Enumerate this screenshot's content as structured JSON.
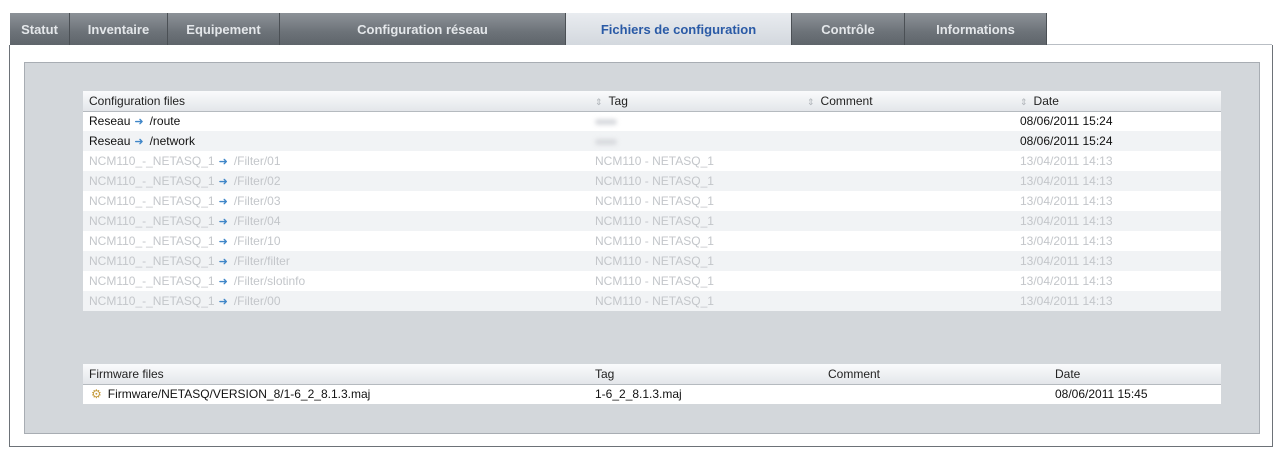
{
  "tabs": [
    {
      "label": "Statut",
      "active": false
    },
    {
      "label": "Inventaire",
      "active": false
    },
    {
      "label": "Equipement",
      "active": false
    },
    {
      "label": "Configuration réseau",
      "active": false
    },
    {
      "label": "Fichiers de configuration",
      "active": true
    },
    {
      "label": "Contrôle",
      "active": false
    },
    {
      "label": "Informations",
      "active": false
    }
  ],
  "config_table": {
    "headers": {
      "name": "Configuration files",
      "tag": "Tag",
      "comment": "Comment",
      "date": "Date"
    },
    "rows": [
      {
        "source": "Reseau",
        "path": "/route",
        "tag": "",
        "comment": "",
        "date": "08/06/2011 15:24",
        "dimmed": false
      },
      {
        "source": "Reseau",
        "path": "/network",
        "tag": "",
        "comment": "",
        "date": "08/06/2011 15:24",
        "dimmed": false
      },
      {
        "source": "NCM110_-_NETASQ_1",
        "path": "/Filter/01",
        "tag": "NCM110 - NETASQ_1",
        "comment": "",
        "date": "13/04/2011 14:13",
        "dimmed": true
      },
      {
        "source": "NCM110_-_NETASQ_1",
        "path": "/Filter/02",
        "tag": "NCM110 - NETASQ_1",
        "comment": "",
        "date": "13/04/2011 14:13",
        "dimmed": true
      },
      {
        "source": "NCM110_-_NETASQ_1",
        "path": "/Filter/03",
        "tag": "NCM110 - NETASQ_1",
        "comment": "",
        "date": "13/04/2011 14:13",
        "dimmed": true
      },
      {
        "source": "NCM110_-_NETASQ_1",
        "path": "/Filter/04",
        "tag": "NCM110 - NETASQ_1",
        "comment": "",
        "date": "13/04/2011 14:13",
        "dimmed": true
      },
      {
        "source": "NCM110_-_NETASQ_1",
        "path": "/Filter/10",
        "tag": "NCM110 - NETASQ_1",
        "comment": "",
        "date": "13/04/2011 14:13",
        "dimmed": true
      },
      {
        "source": "NCM110_-_NETASQ_1",
        "path": "/Filter/filter",
        "tag": "NCM110 - NETASQ_1",
        "comment": "",
        "date": "13/04/2011 14:13",
        "dimmed": true
      },
      {
        "source": "NCM110_-_NETASQ_1",
        "path": "/Filter/slotinfo",
        "tag": "NCM110 - NETASQ_1",
        "comment": "",
        "date": "13/04/2011 14:13",
        "dimmed": true
      },
      {
        "source": "NCM110_-_NETASQ_1",
        "path": "/Filter/00",
        "tag": "NCM110 - NETASQ_1",
        "comment": "",
        "date": "13/04/2011 14:13",
        "dimmed": true
      }
    ]
  },
  "firmware_table": {
    "headers": {
      "name": "Firmware files",
      "tag": "Tag",
      "comment": "Comment",
      "date": "Date"
    },
    "rows": [
      {
        "file": "Firmware/NETASQ/VERSION_8/1-6_2_8.1.3.maj",
        "tag": "1-6_2_8.1.3.maj",
        "comment": "",
        "date": "08/06/2011 15:45"
      }
    ]
  },
  "icons": {
    "row_arrow": "arrow-right-icon",
    "firmware": "gear-icon",
    "sort": "sort-icon"
  },
  "colors": {
    "active_tab_text": "#2a5aa6",
    "tab_bg": "#6c7278",
    "arrow": "#3f86c8"
  }
}
